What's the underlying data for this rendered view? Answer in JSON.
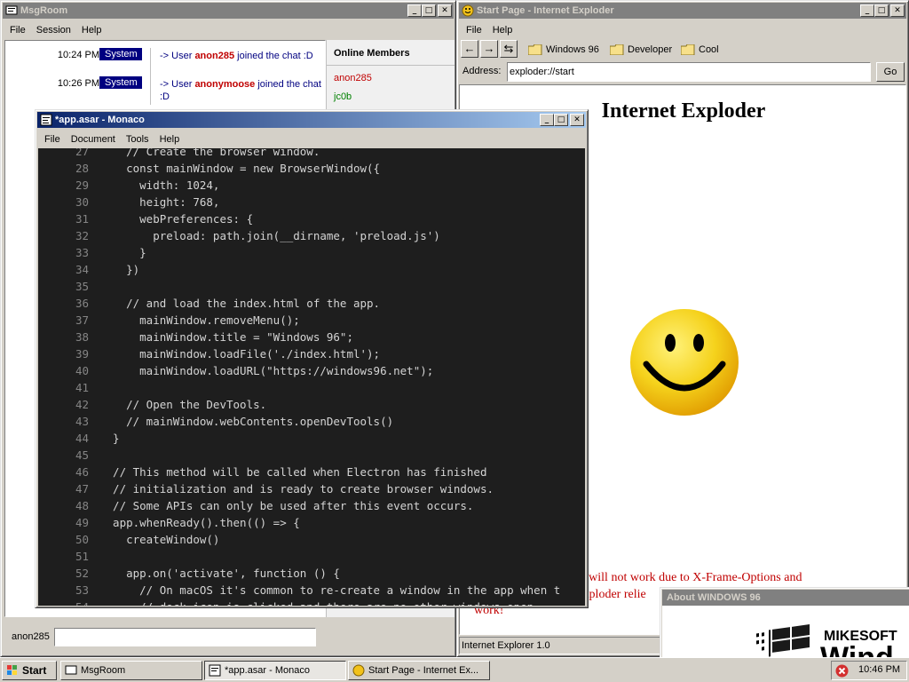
{
  "msgroom": {
    "title": "MsgRoom",
    "menu": [
      "File",
      "Session",
      "Help"
    ],
    "messages": [
      {
        "time": "10:24 PM",
        "badge": "System",
        "pre": "-> User ",
        "user": "anon285",
        "post": " joined the chat :D"
      },
      {
        "time": "10:26 PM",
        "badge": "System",
        "pre": "-> User ",
        "user": "anonymoose",
        "post": " joined the chat :D"
      }
    ],
    "members_title": "Online Members",
    "members": [
      {
        "name": "anon285",
        "color": "#c00000"
      },
      {
        "name": "jc0b",
        "color": "#008000"
      }
    ],
    "nickname": "anon285",
    "input_value": ""
  },
  "ie": {
    "title": "Start Page - Internet Exploder",
    "menu": [
      "File",
      "Help"
    ],
    "nav": {
      "back": "←",
      "forward": "→",
      "refresh": "⇆"
    },
    "bookmarks": [
      "Windows 96",
      "Developer",
      "Cool"
    ],
    "address_label": "Address:",
    "address_value": "exploder://start",
    "go_label": "Go",
    "heading": "Internet Exploder",
    "notice_line1": "es will not work due to X-Frame-Options and",
    "notice_line2": "Exploder relie",
    "notice_line3": "work!",
    "status": "Internet Explorer 1.0"
  },
  "about": {
    "title": "About WINDOWS 96",
    "brand_line1": "MIKESOFT",
    "brand_line2": "Wind"
  },
  "monaco": {
    "title": "*app.asar - Monaco",
    "menu": [
      "File",
      "Document",
      "Tools",
      "Help"
    ],
    "lines": [
      {
        "n": "27",
        "t": "    // Create the browser window."
      },
      {
        "n": "28",
        "t": "    const mainWindow = new BrowserWindow({"
      },
      {
        "n": "29",
        "t": "      width: 1024,"
      },
      {
        "n": "30",
        "t": "      height: 768,"
      },
      {
        "n": "31",
        "t": "      webPreferences: {"
      },
      {
        "n": "32",
        "t": "        preload: path.join(__dirname, 'preload.js')"
      },
      {
        "n": "33",
        "t": "      }"
      },
      {
        "n": "34",
        "t": "    })"
      },
      {
        "n": "35",
        "t": ""
      },
      {
        "n": "36",
        "t": "    // and load the index.html of the app."
      },
      {
        "n": "37",
        "t": "      mainWindow.removeMenu();"
      },
      {
        "n": "38",
        "t": "      mainWindow.title = \"Windows 96\";"
      },
      {
        "n": "39",
        "t": "      mainWindow.loadFile('./index.html');"
      },
      {
        "n": "40",
        "t": "      mainWindow.loadURL(\"https://windows96.net\");"
      },
      {
        "n": "41",
        "t": ""
      },
      {
        "n": "42",
        "t": "    // Open the DevTools."
      },
      {
        "n": "43",
        "t": "    // mainWindow.webContents.openDevTools()"
      },
      {
        "n": "44",
        "t": "  }"
      },
      {
        "n": "45",
        "t": ""
      },
      {
        "n": "46",
        "t": "  // This method will be called when Electron has finished"
      },
      {
        "n": "47",
        "t": "  // initialization and is ready to create browser windows."
      },
      {
        "n": "48",
        "t": "  // Some APIs can only be used after this event occurs."
      },
      {
        "n": "49",
        "t": "  app.whenReady().then(() => {"
      },
      {
        "n": "50",
        "t": "    createWindow()"
      },
      {
        "n": "51",
        "t": ""
      },
      {
        "n": "52",
        "t": "    app.on('activate', function () {"
      },
      {
        "n": "53",
        "t": "      // On macOS it's common to re-create a window in the app when t"
      },
      {
        "n": "54",
        "t": "      // dock icon is clicked and there are no other windows open."
      }
    ]
  },
  "taskbar": {
    "start": "Start",
    "items": [
      "MsgRoom",
      "*app.asar - Monaco",
      "Start Page - Internet Ex..."
    ],
    "clock": "10:46 PM"
  }
}
